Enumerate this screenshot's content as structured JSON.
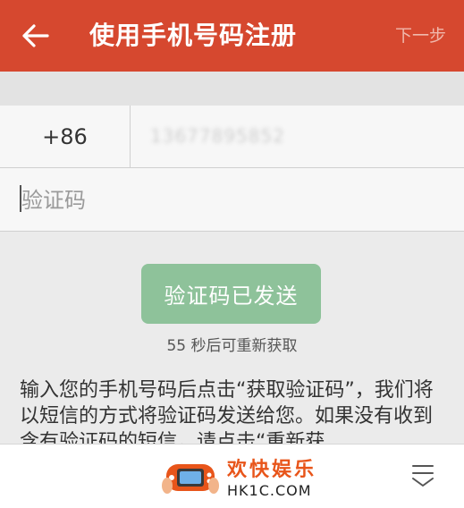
{
  "appbar": {
    "title": "使用手机号码注册",
    "next_label": "下一步",
    "back_icon": "arrow-left-icon",
    "background": "#d6482f"
  },
  "form": {
    "country_code": "+86",
    "phone_number": "13677895852",
    "verify_placeholder": "验证码"
  },
  "send_button": {
    "label": "验证码已发送",
    "color": "#8ec29a"
  },
  "countdown": "55 秒后可重新获取",
  "info_text": "输入您的手机号码后点击“获取验证码”，我们将以短信的方式将验证码发送给您。如果没有收到含有验证码的短信，请点击“重新获",
  "bottom_bar": {
    "logo_cn": "欢快娱乐",
    "logo_en": "HK1C.COM",
    "collapse_icon": "collapse-arrow-icon"
  }
}
